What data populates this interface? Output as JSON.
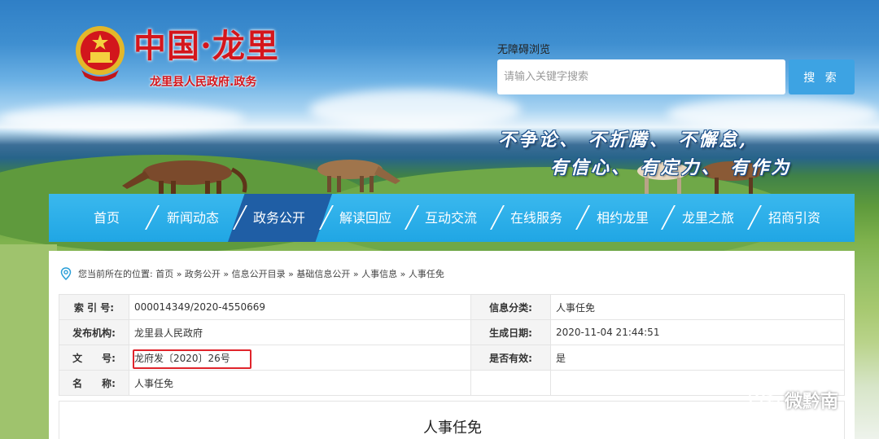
{
  "header": {
    "site_title": "中国·龙里",
    "site_subtitle": "龙里县人民政府.政务",
    "accessibility_link": "无障碍浏览",
    "search_placeholder": "请输入关键字搜索",
    "search_button": "搜 索",
    "slogan_line1": "不争论、 不折腾、 不懈怠,",
    "slogan_line2": "有信心、 有定力、 有作为"
  },
  "nav": {
    "items": [
      {
        "label": "首页"
      },
      {
        "label": "新闻动态"
      },
      {
        "label": "政务公开",
        "active": true
      },
      {
        "label": "解读回应"
      },
      {
        "label": "互动交流"
      },
      {
        "label": "在线服务"
      },
      {
        "label": "相约龙里"
      },
      {
        "label": "龙里之旅"
      },
      {
        "label": "招商引资"
      }
    ]
  },
  "breadcrumb": {
    "text": "您当前所在的位置: 首页 » 政务公开 » 信息公开目录 » 基础信息公开 » 人事信息 » 人事任免"
  },
  "info": {
    "index_label": "索 引 号:",
    "index_value": "000014349/2020-4550669",
    "category_label": "信息分类:",
    "category_value": "人事任免",
    "publisher_label": "发布机构:",
    "publisher_value": "龙里县人民政府",
    "date_label": "生成日期:",
    "date_value": "2020-11-04 21:44:51",
    "docno_label": "文　　号:",
    "docno_value": "龙府发〔2020〕26号",
    "valid_label": "是否有效:",
    "valid_value": "是",
    "name_label": "名　　称:",
    "name_value": "人事任免"
  },
  "document": {
    "title": "人事任免"
  },
  "watermark": {
    "text": "微黔南"
  },
  "colors": {
    "nav_bg": "#20a6e4",
    "nav_active": "#1f5ea5",
    "title_red": "#d4161c",
    "search_button": "#3da3e3",
    "highlight_border": "#e0242b"
  },
  "icons": [
    "national-emblem-icon",
    "location-pin-icon",
    "wechat-icon"
  ]
}
